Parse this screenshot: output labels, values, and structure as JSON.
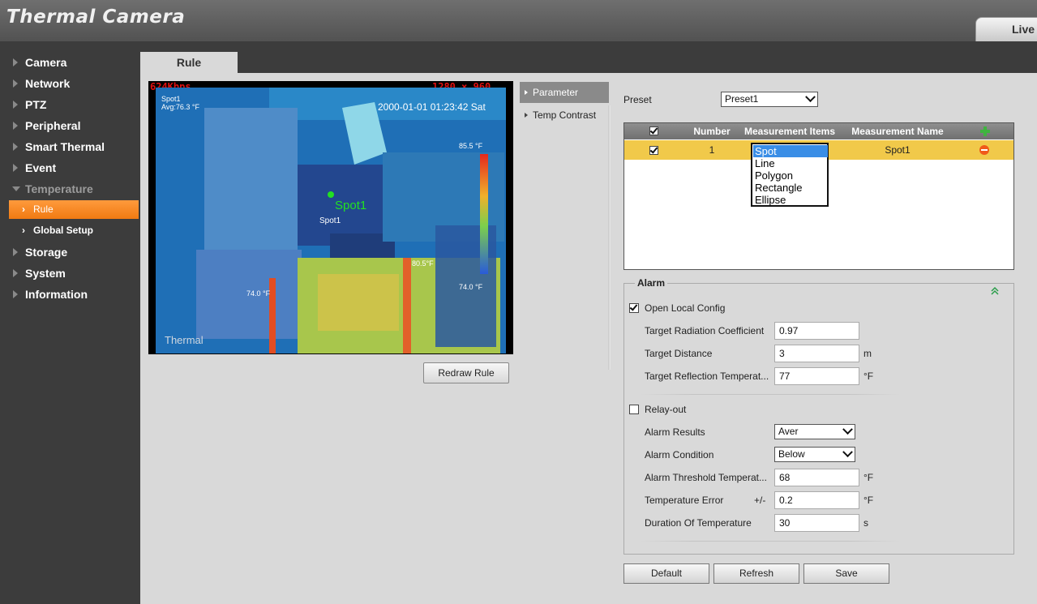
{
  "app": {
    "title": "Thermal Camera",
    "live_tab": "Live"
  },
  "sidebar": {
    "items": [
      {
        "label": "Camera"
      },
      {
        "label": "Network"
      },
      {
        "label": "PTZ"
      },
      {
        "label": "Peripheral"
      },
      {
        "label": "Smart Thermal"
      },
      {
        "label": "Event"
      },
      {
        "label": "Temperature",
        "expanded": true
      },
      {
        "label": "Storage"
      },
      {
        "label": "System"
      },
      {
        "label": "Information"
      }
    ],
    "sub_items": [
      {
        "label": "Rule",
        "active": true
      },
      {
        "label": "Global Setup"
      }
    ]
  },
  "tab": {
    "label": "Rule"
  },
  "video": {
    "bitrate": "624Kbps",
    "resolution": "1280 × 960",
    "spot_label": "Spot1",
    "avg": "Avg:76.3 °F",
    "datetime": "2000-01-01 01:23:42 Sat",
    "marker_label": "Spot1",
    "marker_small_label": "Spot1",
    "scale_max": "85.5 °F",
    "scale_min": "74.0 °F",
    "temp_mid": "80.5°F",
    "temp_low": "74.0 °F",
    "channel": "Thermal"
  },
  "redraw_button": "Redraw Rule",
  "side_menu": [
    {
      "label": "Parameter",
      "active": true
    },
    {
      "label": "Temp Contrast"
    }
  ],
  "preset": {
    "label": "Preset",
    "value": "Preset1"
  },
  "table": {
    "headers": [
      "Number",
      "Measurement Items",
      "Measurement Name"
    ],
    "rows": [
      {
        "number": "1",
        "item": "Spot",
        "name": "Spot1"
      }
    ]
  },
  "item_dropdown": {
    "options": [
      "Spot",
      "Line",
      "Polygon",
      "Rectangle",
      "Ellipse"
    ],
    "selected": "Spot"
  },
  "alarm": {
    "title": "Alarm",
    "open_local_config": {
      "label": "Open Local Config",
      "checked": true
    },
    "radiation": {
      "label": "Target Radiation Coefficient",
      "value": "0.97"
    },
    "distance": {
      "label": "Target Distance",
      "value": "3",
      "unit": "m"
    },
    "reflection": {
      "label": "Target Reflection Temperat...",
      "value": "77",
      "unit": "°F"
    },
    "relay_out": {
      "label": "Relay-out",
      "checked": false
    },
    "results": {
      "label": "Alarm Results",
      "value": "Aver"
    },
    "condition": {
      "label": "Alarm Condition",
      "value": "Below"
    },
    "threshold": {
      "label": "Alarm Threshold Temperat...",
      "value": "68",
      "unit": "°F"
    },
    "error": {
      "label": "Temperature Error",
      "prefix": "+/-",
      "value": "0.2",
      "unit": "°F"
    },
    "duration": {
      "label": "Duration Of Temperature",
      "value": "30",
      "unit": "s"
    }
  },
  "buttons": {
    "default": "Default",
    "refresh": "Refresh",
    "save": "Save"
  },
  "colors": {
    "accent": "#f48a22",
    "selected_row": "#f1c94a",
    "header_bg": "#5a5a5a",
    "sidebar_bg": "#3c3c3c"
  }
}
